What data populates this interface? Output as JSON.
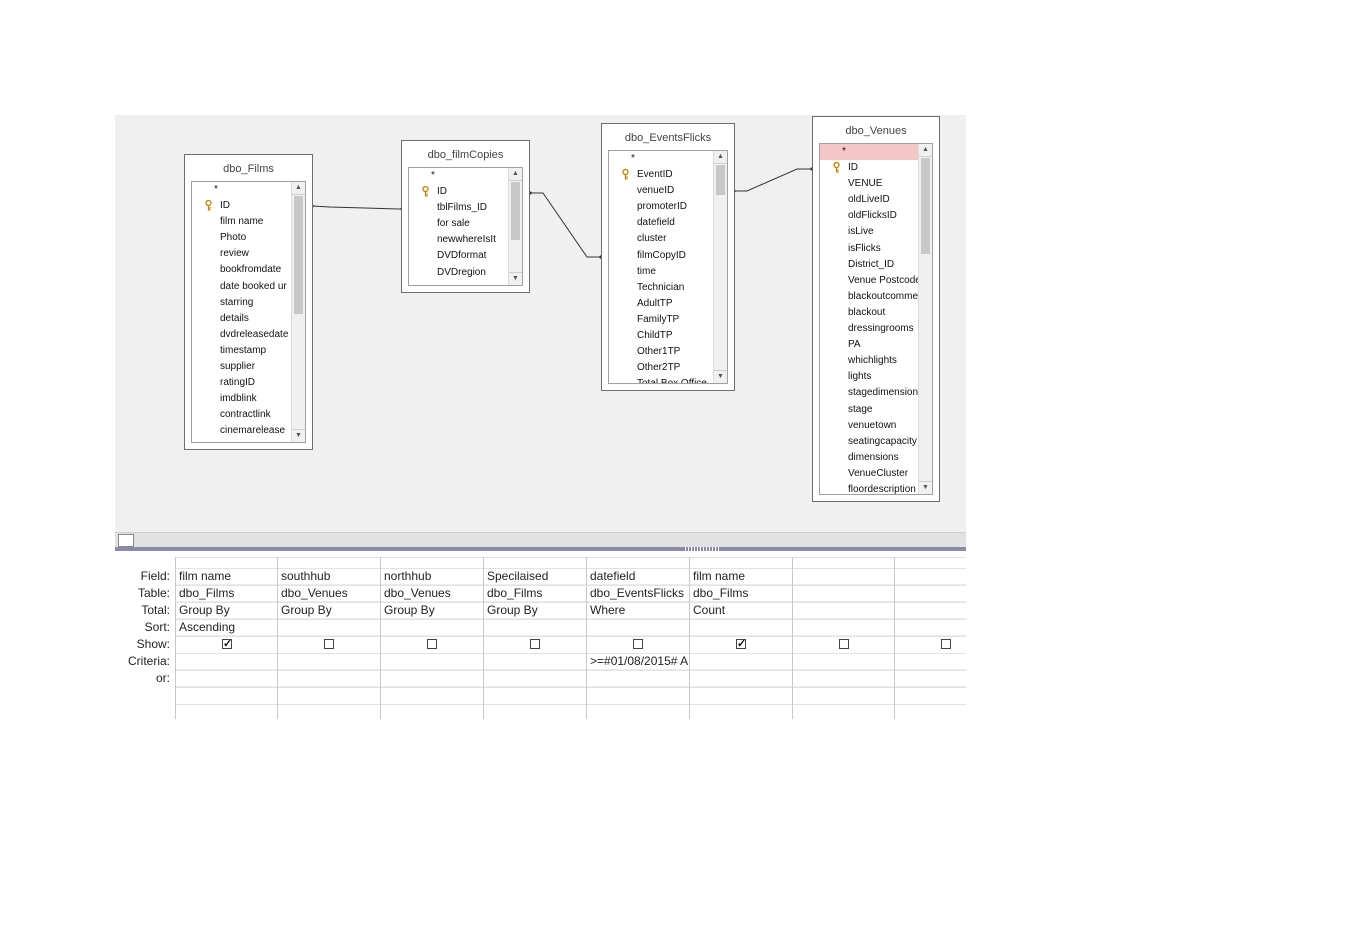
{
  "tables": [
    {
      "title": "dbo_Films",
      "fields": [
        "*",
        "ID",
        "film name",
        "Photo",
        "review",
        "bookfromdate",
        "date booked ur",
        "starring",
        "details",
        "dvdreleasedate",
        "timestamp",
        "supplier",
        "ratingID",
        "imdblink",
        "contractlink",
        "cinemarelease"
      ],
      "key_index": 1
    },
    {
      "title": "dbo_filmCopies",
      "fields": [
        "*",
        "ID",
        "tblFilms_ID",
        "for sale",
        "newwhereIsIt",
        "DVDformat",
        "DVDregion"
      ],
      "key_index": 1
    },
    {
      "title": "dbo_EventsFlicks",
      "fields": [
        "*",
        "EventID",
        "venueID",
        "promoterID",
        "datefield",
        "cluster",
        "filmCopyID",
        "time",
        "Technician",
        "AdultTP",
        "FamilyTP",
        "ChildTP",
        "Other1TP",
        "Other2TP",
        "Total Box Office"
      ],
      "key_index": 1
    },
    {
      "title": "dbo_Venues",
      "fields": [
        "*",
        "ID",
        "VENUE",
        "oldLiveID",
        "oldFlicksID",
        "isLive",
        "isFlicks",
        "District_ID",
        "Venue Postcode",
        "blackoutcomme",
        "blackout",
        "dressingrooms",
        "PA",
        "whichlights",
        "lights",
        "stagedimension",
        "stage",
        "venuetown",
        "seatingcapacity",
        "dimensions",
        "VenueCluster",
        "floordescription"
      ],
      "key_index": 1,
      "selected_index": 0
    }
  ],
  "grid": {
    "row_labels": [
      "Field:",
      "Table:",
      "Total:",
      "Sort:",
      "Show:",
      "Criteria:",
      "or:"
    ],
    "columns": [
      {
        "field": "film name",
        "table": "dbo_Films",
        "total": "Group By",
        "sort": "Ascending",
        "show": true,
        "criteria": "",
        "or": ""
      },
      {
        "field": "southhub",
        "table": "dbo_Venues",
        "total": "Group By",
        "sort": "",
        "show": false,
        "criteria": "",
        "or": ""
      },
      {
        "field": "northhub",
        "table": "dbo_Venues",
        "total": "Group By",
        "sort": "",
        "show": false,
        "criteria": "",
        "or": ""
      },
      {
        "field": "Specilaised",
        "table": "dbo_Films",
        "total": "Group By",
        "sort": "",
        "show": false,
        "criteria": "",
        "or": ""
      },
      {
        "field": "datefield",
        "table": "dbo_EventsFlicks",
        "total": "Where",
        "sort": "",
        "show": false,
        "criteria": ">=#01/08/2015# A",
        "or": ""
      },
      {
        "field": "film name",
        "table": "dbo_Films",
        "total": "Count",
        "sort": "",
        "show": true,
        "criteria": "",
        "or": ""
      },
      {
        "field": "",
        "table": "",
        "total": "",
        "sort": "",
        "show": false,
        "criteria": "",
        "or": ""
      },
      {
        "field": "",
        "table": "",
        "total": "",
        "sort": "",
        "show": false,
        "criteria": "",
        "or": ""
      }
    ]
  },
  "colors": {
    "designer_bg": "#f0f0f0",
    "selected_field": "#f5c6c6",
    "splitter": "#8a8aa8",
    "key_icon": "#b8860b"
  },
  "icons": {
    "key": "primary-key-icon",
    "checkbox": "show-checkbox",
    "scroll_up": "scroll-up-arrow-icon",
    "scroll_down": "scroll-down-arrow-icon"
  }
}
